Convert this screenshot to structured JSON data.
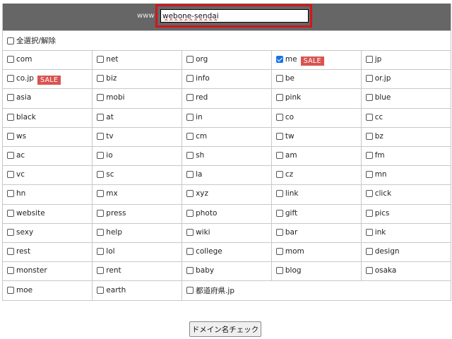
{
  "header": {
    "prefix": "www",
    "domain_value": "webone-sendai"
  },
  "select_all": {
    "label": "全選択/解除",
    "checked": false
  },
  "sale_badge": "SALE",
  "tlds": [
    [
      "com",
      "net",
      "org",
      "me",
      "jp"
    ],
    [
      "co.jp",
      "biz",
      "info",
      "be",
      "or.jp"
    ],
    [
      "asia",
      "mobi",
      "red",
      "pink",
      "blue"
    ],
    [
      "black",
      "at",
      "in",
      "co",
      "cc"
    ],
    [
      "ws",
      "tv",
      "cm",
      "tw",
      "bz"
    ],
    [
      "ac",
      "io",
      "sh",
      "am",
      "fm"
    ],
    [
      "vc",
      "sc",
      "la",
      "cz",
      "mn"
    ],
    [
      "hn",
      "mx",
      "xyz",
      "link",
      "click"
    ],
    [
      "website",
      "press",
      "photo",
      "gift",
      "pics"
    ],
    [
      "sexy",
      "help",
      "wiki",
      "bar",
      "ink"
    ],
    [
      "rest",
      "lol",
      "college",
      "mom",
      "design"
    ],
    [
      "monster",
      "rent",
      "baby",
      "blog",
      "osaka"
    ],
    [
      "moe",
      "earth",
      "都道府県.jp"
    ]
  ],
  "checked": [
    "me"
  ],
  "sale": [
    "me",
    "co.jp"
  ],
  "submit_label": "ドメイン名チェック",
  "colors": {
    "header_bg": "#666666",
    "highlight": "#d0171b",
    "sale_bg": "#d9534f",
    "check_blue": "#1a73e8"
  }
}
